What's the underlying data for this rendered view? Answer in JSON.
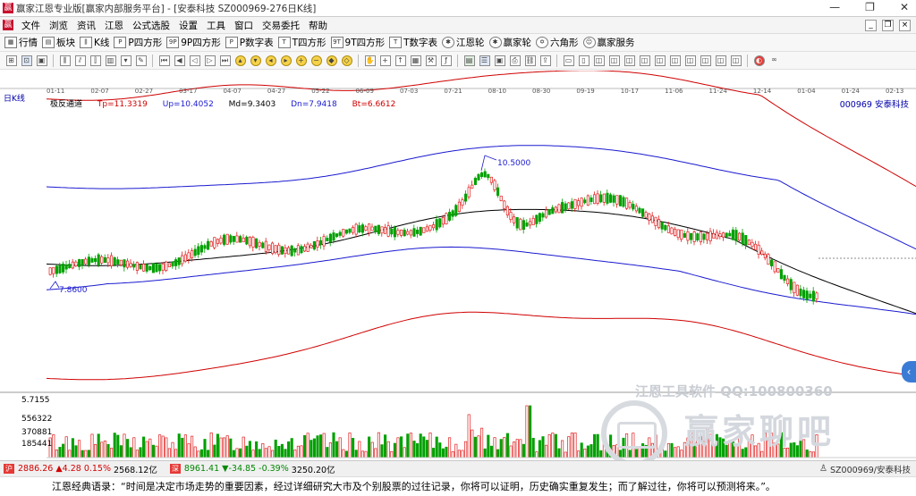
{
  "window": {
    "app_icon_text": "赢",
    "title": "赢家江恩专业版[赢家内部服务平台] - [安泰科技  SZ000969-276日K线]",
    "controls": [
      "—",
      "❐",
      "✕"
    ]
  },
  "menubar": {
    "items": [
      "文件",
      "浏览",
      "资讯",
      "江恩",
      "公式选股",
      "设置",
      "工具",
      "窗口",
      "交易委托",
      "帮助"
    ],
    "right_controls": [
      "_",
      "❐",
      "×"
    ]
  },
  "toolbar": {
    "items": [
      {
        "icon": "grid-icon",
        "label": "行情"
      },
      {
        "icon": "blocks-icon",
        "label": "板块"
      },
      {
        "icon": "candle-icon",
        "label": "K线"
      },
      {
        "icon": "p-square-icon",
        "label": "P四方形"
      },
      {
        "icon": "9p-square-icon",
        "label": "9P四方形"
      },
      {
        "icon": "p-table-icon",
        "label": "P数字表"
      },
      {
        "icon": "t-square-icon",
        "label": "T四方形"
      },
      {
        "icon": "9t-square-icon",
        "label": "9T四方形"
      },
      {
        "icon": "t-table-icon",
        "label": "T数字表"
      },
      {
        "icon": "gann-wheel-icon",
        "label": "江恩轮"
      },
      {
        "icon": "winner-wheel-icon",
        "label": "赢家轮"
      },
      {
        "icon": "hexagon-icon",
        "label": "六角形"
      },
      {
        "icon": "service-icon",
        "label": "赢家服务"
      }
    ]
  },
  "chart_header": {
    "period": "日K线",
    "dates": [
      "01-11",
      "02-07",
      "02-27",
      "03-17",
      "04-07",
      "04-27",
      "05-22",
      "06-09",
      "07-03",
      "07-21",
      "08-10",
      "08-30",
      "09-19",
      "10-17",
      "11-06",
      "11-24",
      "12-14",
      "01-04",
      "01-24",
      "02-13"
    ],
    "indicator_name": "极反通道",
    "tp": "Tp=11.3319",
    "up": "Up=10.4052",
    "md": "Md=9.3403",
    "dn": "Dn=7.9418",
    "bt": "Bt=6.6612",
    "stock": "000969  安泰科技"
  },
  "chart_data": {
    "type": "candlestick",
    "annotations": [
      "10.5000",
      "7.8600"
    ],
    "volume_axis_labels": [
      "5.7155",
      "556322",
      "370881",
      "185441"
    ],
    "colors": {
      "up": "#e02020",
      "down": "#00a000",
      "upper_band": "#d00000",
      "mid_band": "#1a1ad0",
      "middle": "#000000"
    }
  },
  "watermark": {
    "line1": "江恩工具软件  QQ:100800360",
    "line2": "赢家聊吧"
  },
  "statusbar": {
    "sh_icon": "沪",
    "sh_price": "2886.26",
    "sh_change": "▲4.28",
    "sh_pct": "0.15%",
    "sh_amount": "2568.12亿",
    "sz_icon": "深",
    "sz_price": "8961.41",
    "sz_change": "▼-34.85",
    "sz_pct": "-0.39%",
    "sz_amount": "3250.20亿",
    "right_text": "SZ000969/安泰科技"
  },
  "quote": {
    "text": "江恩经典语录：“时间是决定市场走势的重要因素，经过详细研究大市及个别股票的过往记录，你将可以证明，历史确实重复发生；而了解过往，你将可以预测将来。”。"
  }
}
